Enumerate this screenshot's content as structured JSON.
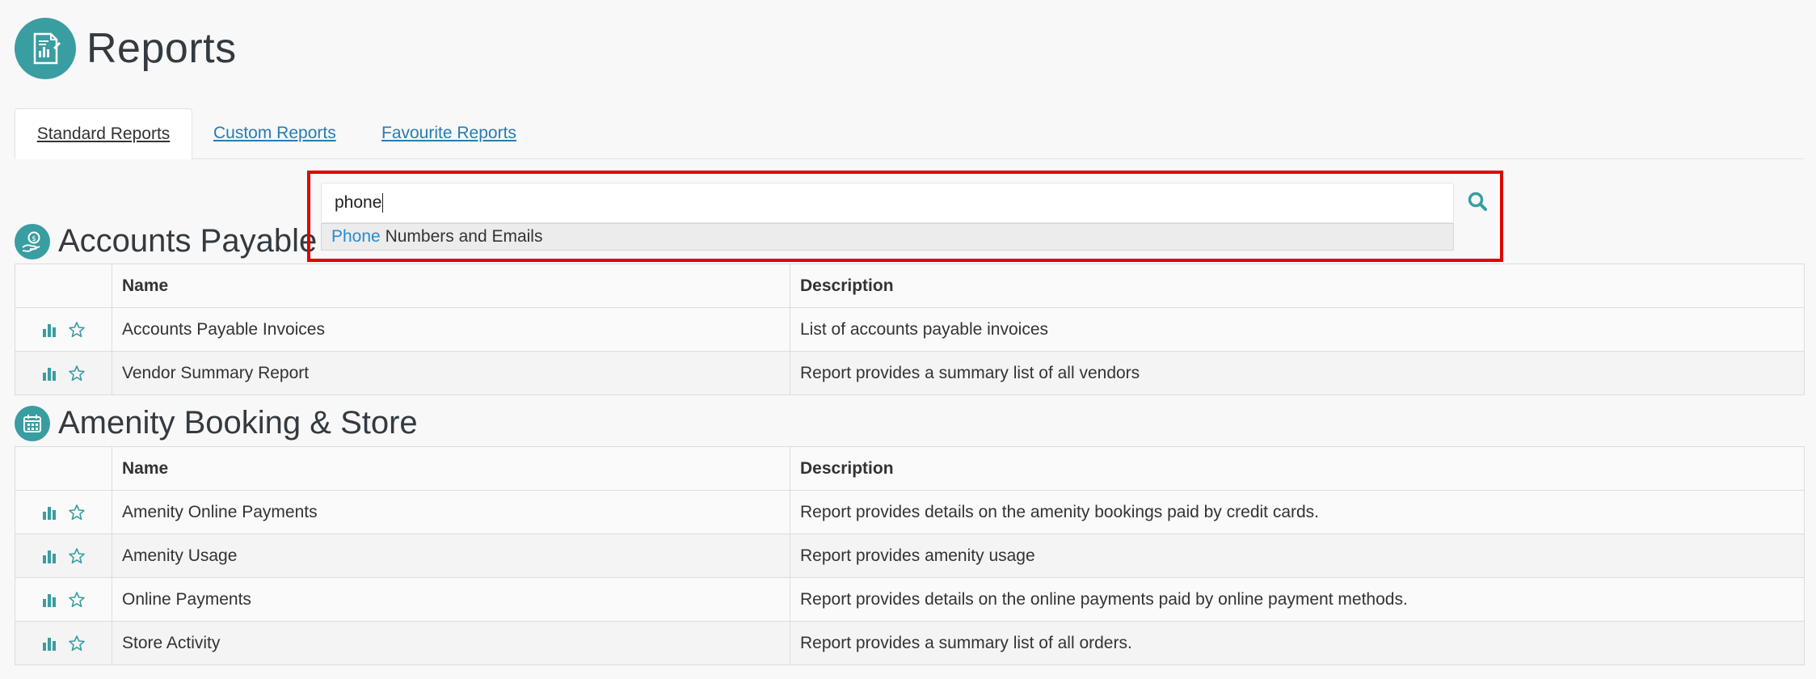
{
  "header": {
    "title": "Reports",
    "icon": "report-document-icon"
  },
  "tabs": [
    {
      "label": "Standard Reports",
      "active": true
    },
    {
      "label": "Custom Reports",
      "active": false
    },
    {
      "label": "Favourite Reports",
      "active": false
    }
  ],
  "search": {
    "value": "phone",
    "suggestion_match": "Phone",
    "suggestion_rest": " Numbers and Emails",
    "button_icon": "search-icon"
  },
  "columns": {
    "name": "Name",
    "description": "Description"
  },
  "sections": [
    {
      "title": "Accounts Payable",
      "icon": "hand-coin-icon",
      "rows": [
        {
          "name": "Accounts Payable Invoices",
          "description": "List of accounts payable invoices"
        },
        {
          "name": "Vendor Summary Report",
          "description": "Report provides a summary list of all vendors"
        }
      ]
    },
    {
      "title": "Amenity Booking & Store",
      "icon": "calendar-icon",
      "rows": [
        {
          "name": "Amenity Online Payments",
          "description": "Report provides details on the amenity bookings paid by credit cards."
        },
        {
          "name": "Amenity Usage",
          "description": "Report provides amenity usage"
        },
        {
          "name": "Online Payments",
          "description": "Report provides details on the online payments paid by online payment methods."
        },
        {
          "name": "Store Activity",
          "description": "Report provides a summary list of all orders."
        }
      ]
    }
  ],
  "colors": {
    "accent": "#3a9da1",
    "link": "#2a7bb0",
    "highlight": "#e00000"
  }
}
